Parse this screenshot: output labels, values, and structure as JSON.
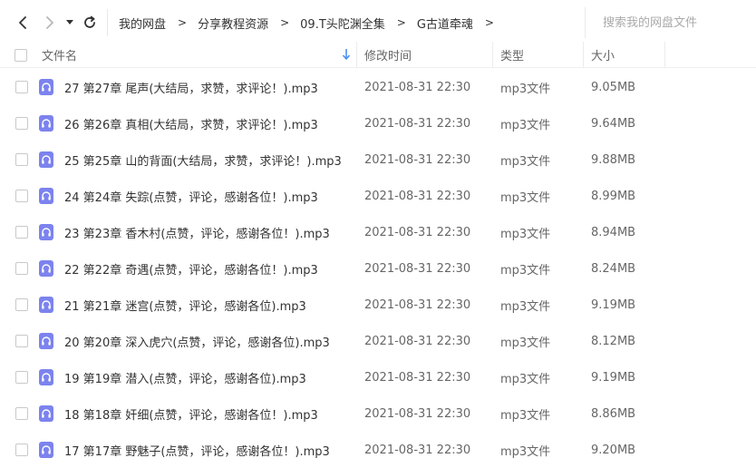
{
  "colors": {
    "accent": "#4c8ff6",
    "audio_icon": "#7c83ee",
    "text": "#333333",
    "muted": "#666666"
  },
  "nav": {
    "back_icon": "chevron-left-icon",
    "forward_icon": "chevron-right-icon",
    "history_icon": "caret-down-icon",
    "refresh_icon": "refresh-icon"
  },
  "breadcrumb": {
    "items": [
      "我的网盘",
      "分享教程资源",
      "09.T头陀渊全集",
      "G古道牵魂"
    ],
    "separator": ">"
  },
  "search": {
    "placeholder": "搜索我的网盘文件",
    "value": ""
  },
  "table": {
    "headers": {
      "name": "文件名",
      "time": "修改时间",
      "type": "类型",
      "size": "大小"
    },
    "sorted_by": "name",
    "rows": [
      {
        "name": "27 第27章 尾声(大结局，求赞，求评论！).mp3",
        "time": "2021-08-31 22:30",
        "type": "mp3文件",
        "size": "9.05MB"
      },
      {
        "name": "26 第26章 真相(大结局，求赞，求评论！).mp3",
        "time": "2021-08-31 22:30",
        "type": "mp3文件",
        "size": "9.64MB"
      },
      {
        "name": "25 第25章 山的背面(大结局，求赞，求评论！).mp3",
        "time": "2021-08-31 22:30",
        "type": "mp3文件",
        "size": "9.88MB"
      },
      {
        "name": "24 第24章 失踪(点赞，评论，感谢各位！).mp3",
        "time": "2021-08-31 22:30",
        "type": "mp3文件",
        "size": "8.99MB"
      },
      {
        "name": "23 第23章 香木村(点赞，评论，感谢各位！).mp3",
        "time": "2021-08-31 22:30",
        "type": "mp3文件",
        "size": "8.94MB"
      },
      {
        "name": "22 第22章 奇遇(点赞，评论，感谢各位！).mp3",
        "time": "2021-08-31 22:30",
        "type": "mp3文件",
        "size": "8.24MB"
      },
      {
        "name": "21 第21章 迷宫(点赞，评论，感谢各位).mp3",
        "time": "2021-08-31 22:30",
        "type": "mp3文件",
        "size": "9.19MB"
      },
      {
        "name": "20 第20章 深入虎穴(点赞，评论，感谢各位).mp3",
        "time": "2021-08-31 22:30",
        "type": "mp3文件",
        "size": "8.12MB"
      },
      {
        "name": "19 第19章 潜入(点赞，评论，感谢各位).mp3",
        "time": "2021-08-31 22:30",
        "type": "mp3文件",
        "size": "9.19MB"
      },
      {
        "name": "18 第18章 奸细(点赞，评论，感谢各位！).mp3",
        "time": "2021-08-31 22:30",
        "type": "mp3文件",
        "size": "8.86MB"
      },
      {
        "name": "17 第17章 野魅子(点赞，评论，感谢各位！).mp3",
        "time": "2021-08-31 22:30",
        "type": "mp3文件",
        "size": "9.20MB"
      }
    ],
    "row_icon": "headphones-icon"
  }
}
